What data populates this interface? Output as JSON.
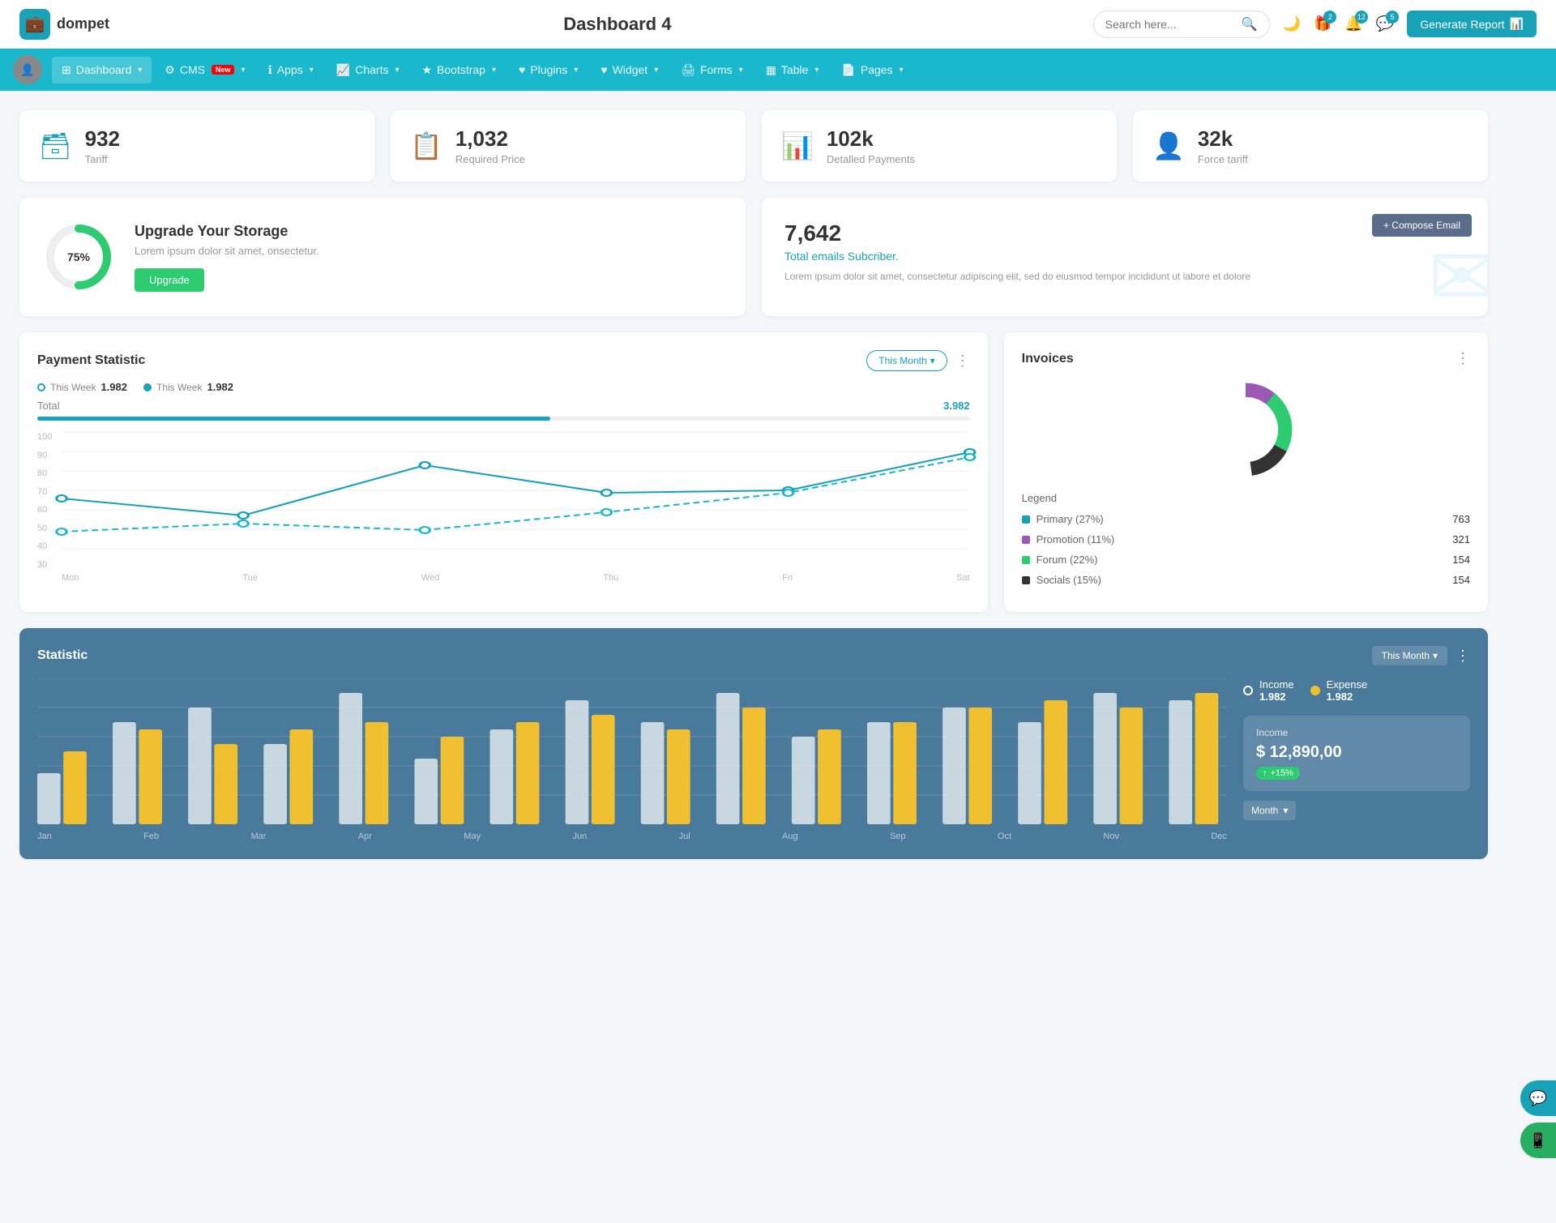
{
  "app": {
    "logo_text": "dompet",
    "page_title": "Dashboard 4",
    "search_placeholder": "Search here..."
  },
  "header": {
    "badges": {
      "gift": "2",
      "bell": "12",
      "chat": "5"
    },
    "generate_btn": "Generate Report"
  },
  "navbar": {
    "items": [
      {
        "label": "Dashboard",
        "icon": "grid",
        "has_arrow": true,
        "active": true
      },
      {
        "label": "CMS",
        "icon": "gear",
        "has_arrow": true,
        "badge": "New"
      },
      {
        "label": "Apps",
        "icon": "info",
        "has_arrow": true
      },
      {
        "label": "Charts",
        "icon": "chart",
        "has_arrow": true
      },
      {
        "label": "Bootstrap",
        "icon": "star",
        "has_arrow": true
      },
      {
        "label": "Plugins",
        "icon": "heart",
        "has_arrow": true
      },
      {
        "label": "Widget",
        "icon": "heart",
        "has_arrow": true
      },
      {
        "label": "Forms",
        "icon": "printer",
        "has_arrow": true
      },
      {
        "label": "Table",
        "icon": "table",
        "has_arrow": true
      },
      {
        "label": "Pages",
        "icon": "pages",
        "has_arrow": true
      }
    ]
  },
  "stat_cards": [
    {
      "value": "932",
      "label": "Tariff",
      "icon": "briefcase",
      "color": "teal"
    },
    {
      "value": "1,032",
      "label": "Required Price",
      "icon": "file-add",
      "color": "red"
    },
    {
      "value": "102k",
      "label": "Detalled Payments",
      "icon": "bar-chart",
      "color": "purple"
    },
    {
      "value": "32k",
      "label": "Force tariff",
      "icon": "user-box",
      "color": "pink"
    }
  ],
  "storage_card": {
    "percent": "75%",
    "title": "Upgrade Your Storage",
    "description": "Lorem ipsum dolor sit amet, onsectetur.",
    "button_label": "Upgrade"
  },
  "email_card": {
    "count": "7,642",
    "subtitle": "Total emails Subcriber.",
    "description": "Lorem ipsum dolor sit amet, consectetur adipiscing elit, sed do eiusmod tempor incididunt ut labore et dolore",
    "compose_btn": "+ Compose Email"
  },
  "payment_statistic": {
    "title": "Payment Statistic",
    "filter": "This Month",
    "legend": [
      {
        "label": "This Week",
        "value": "1.982"
      },
      {
        "label": "This Week",
        "value": "1.982"
      }
    ],
    "total_label": "Total",
    "total_value": "3.982",
    "progress": 55,
    "x_labels": [
      "Mon",
      "Tue",
      "Wed",
      "Thu",
      "Fri",
      "Sat"
    ],
    "y_labels": [
      "100",
      "90",
      "80",
      "70",
      "60",
      "50",
      "40",
      "30"
    ],
    "line1": [
      60,
      50,
      80,
      63,
      65,
      88
    ],
    "line2": [
      40,
      45,
      41,
      52,
      63,
      85
    ]
  },
  "invoices": {
    "title": "Invoices",
    "donut": {
      "segments": [
        {
          "label": "Primary (27%)",
          "value": 763,
          "color": "#17a2b8",
          "percent": 27
        },
        {
          "label": "Promotion (11%)",
          "value": 321,
          "color": "#9b59b6",
          "percent": 11
        },
        {
          "label": "Forum (22%)",
          "value": 154,
          "color": "#2ecc71",
          "percent": 22
        },
        {
          "label": "Socials (15%)",
          "value": 154,
          "color": "#333",
          "percent": 15
        }
      ]
    }
  },
  "statistic": {
    "title": "Statistic",
    "filter": "This Month",
    "income_label": "Income",
    "income_value": "1.982",
    "expense_label": "Expense",
    "expense_value": "1.982",
    "income_box": {
      "label": "Income",
      "amount": "$ 12,890,00",
      "badge": "+15%"
    },
    "bars": [
      15,
      28,
      35,
      22,
      40,
      18,
      25,
      38,
      30,
      45,
      20,
      32,
      28,
      42,
      35,
      22
    ],
    "bars_alt": [
      22,
      35,
      25,
      35,
      28,
      32,
      20,
      30,
      38,
      30,
      35,
      25,
      38,
      30,
      45,
      38
    ],
    "month_selector": "Month"
  }
}
